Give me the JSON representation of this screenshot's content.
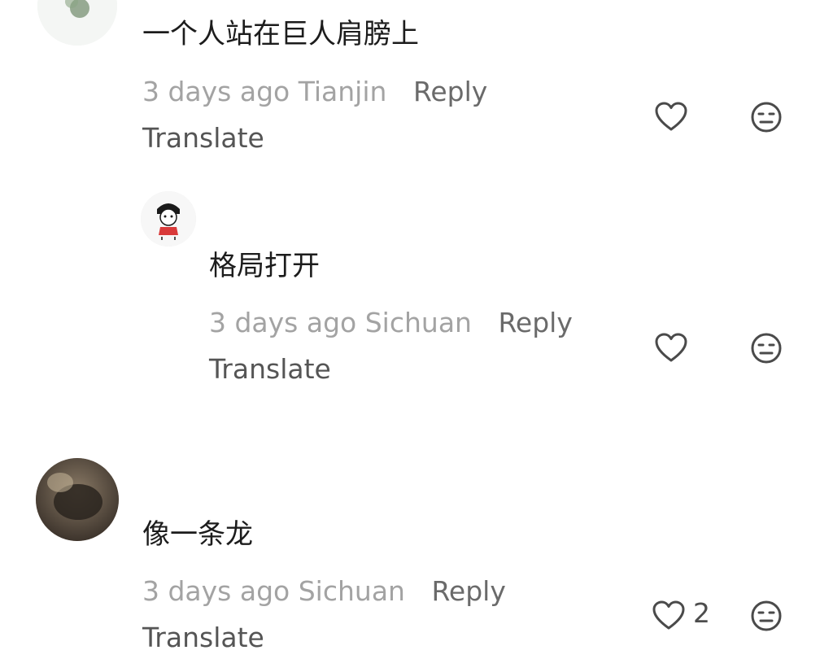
{
  "comments": [
    {
      "text": "一个人站在巨人肩膀上",
      "time": "3 days ago",
      "location": "Tianjin",
      "reply_label": "Reply",
      "translate_label": "Translate",
      "like_count": ""
    },
    {
      "text": "格局打开",
      "time": "3 days ago",
      "location": "Sichuan",
      "reply_label": "Reply",
      "translate_label": "Translate",
      "like_count": ""
    },
    {
      "text": "像一条龙",
      "time": "3 days ago",
      "location": "Sichuan",
      "reply_label": "Reply",
      "translate_label": "Translate",
      "like_count": "2"
    }
  ],
  "icons": {
    "like": "heart-outline-icon",
    "dislike": "neutral-face-icon"
  },
  "colors": {
    "text": "#1c1c1c",
    "muted": "#a3a3a3",
    "action": "#6a6a6a",
    "icon": "#4a4a4a"
  }
}
